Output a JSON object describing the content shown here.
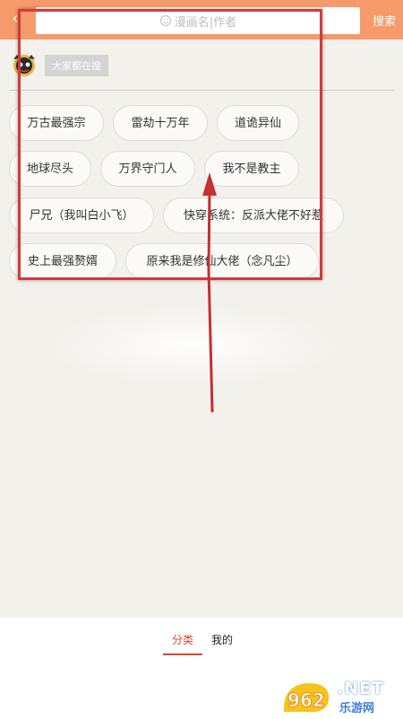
{
  "header": {
    "back_icon": "chevron-left-icon",
    "search_placeholder": "漫画名|作者",
    "search_button": "搜索"
  },
  "hot": {
    "label": "大家都在搜",
    "items": [
      "万古最强宗",
      "雷劫十万年",
      "道诡异仙",
      "地球尽头",
      "万界守门人",
      "我不是教主",
      "尸兄（我叫白小飞）",
      "快穿系统：反派大佬不好惹",
      "史上最强赘婿",
      "原来我是修仙大佬（念凡尘）"
    ]
  },
  "bottom_nav": {
    "tab_category": "分类",
    "tab_mine": "我的"
  },
  "watermark": {
    "logo_text": "962",
    "net": ".NET",
    "cn": "乐游网"
  },
  "colors": {
    "header_bg": "#f59a6a",
    "accent": "#d9472c",
    "annotation": "#d43a3a"
  }
}
